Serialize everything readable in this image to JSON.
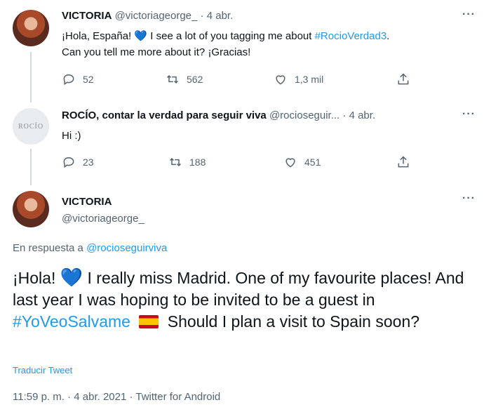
{
  "tweet1": {
    "name": "VICTORIA",
    "handle": "@victoriageorge_",
    "dot": "·",
    "date": "4 abr.",
    "more": "···",
    "text_a": "¡Hola, España!",
    "heart": "💙",
    "text_b": "I see a lot of you tagging me about",
    "hashtag": "#RocioVerdad3",
    "text_c": ".",
    "text_line2": "Can you tell me more about it? ¡Gracias!",
    "replies": "52",
    "retweets": "562",
    "likes": "1,3 mil"
  },
  "tweet2": {
    "avatar_text": "ROCÍO",
    "name": "ROCÍO, contar la verdad para seguir viva",
    "handle": "@rocioseguir...",
    "dot": "·",
    "date": "4 abr.",
    "more": "···",
    "text": "Hi :)",
    "replies": "23",
    "retweets": "188",
    "likes": "451"
  },
  "main_tweet": {
    "name": "VICTORIA",
    "handle": "@victoriageorge_",
    "more": "···",
    "reply_prefix": "En respuesta a",
    "reply_mention": "@rocioseguirviva",
    "text_a": "¡Hola!",
    "heart": "💙",
    "text_b": "I really miss Madrid. One of my favourite places! And last year I was hoping to be invited to be a guest in",
    "hashtag": "#YoVeoSalvame",
    "text_c": "Should I plan a visit to Spain soon?",
    "translate": "Traducir Tweet",
    "timestamp": "11:59 p. m. · 4 abr. 2021 · Twitter for Android"
  },
  "colors": {
    "accent": "#1d9bf0",
    "muted": "#536471",
    "text": "#0f1419"
  }
}
